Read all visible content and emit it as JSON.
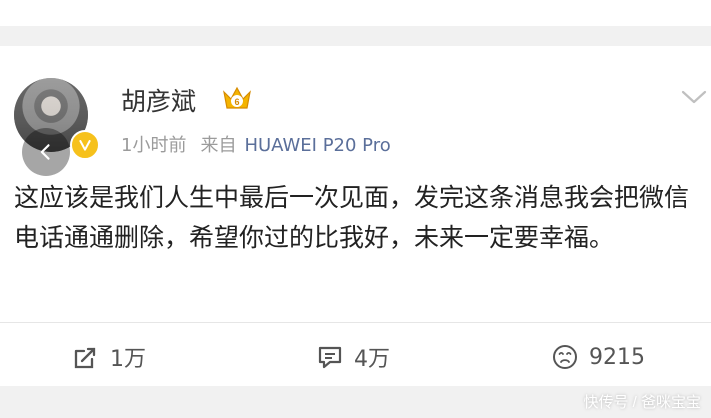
{
  "post": {
    "username": "胡彦斌",
    "time": "1小时前",
    "source_label": "来自",
    "device": "HUAWEI P20 Pro",
    "text": "这应该是我们人生中最后一次见面，发完这条消息我会把微信电话通通删除，希望你过的比我好，未来一定要幸福。",
    "membership_level": "6"
  },
  "actions": {
    "repost_count": "1万",
    "comment_count": "4万",
    "like_count": "9215"
  },
  "watermark": "快传号 / 爸咪宝宝",
  "icons": [
    "back-icon",
    "verified-icon",
    "crown-icon",
    "chevron-down-icon",
    "repost-icon",
    "comment-icon",
    "like-icon"
  ],
  "colors": {
    "name": "#333333",
    "meta": "#9b9b9b",
    "device": "#5b6f9a",
    "badge": "#f6c11c"
  }
}
